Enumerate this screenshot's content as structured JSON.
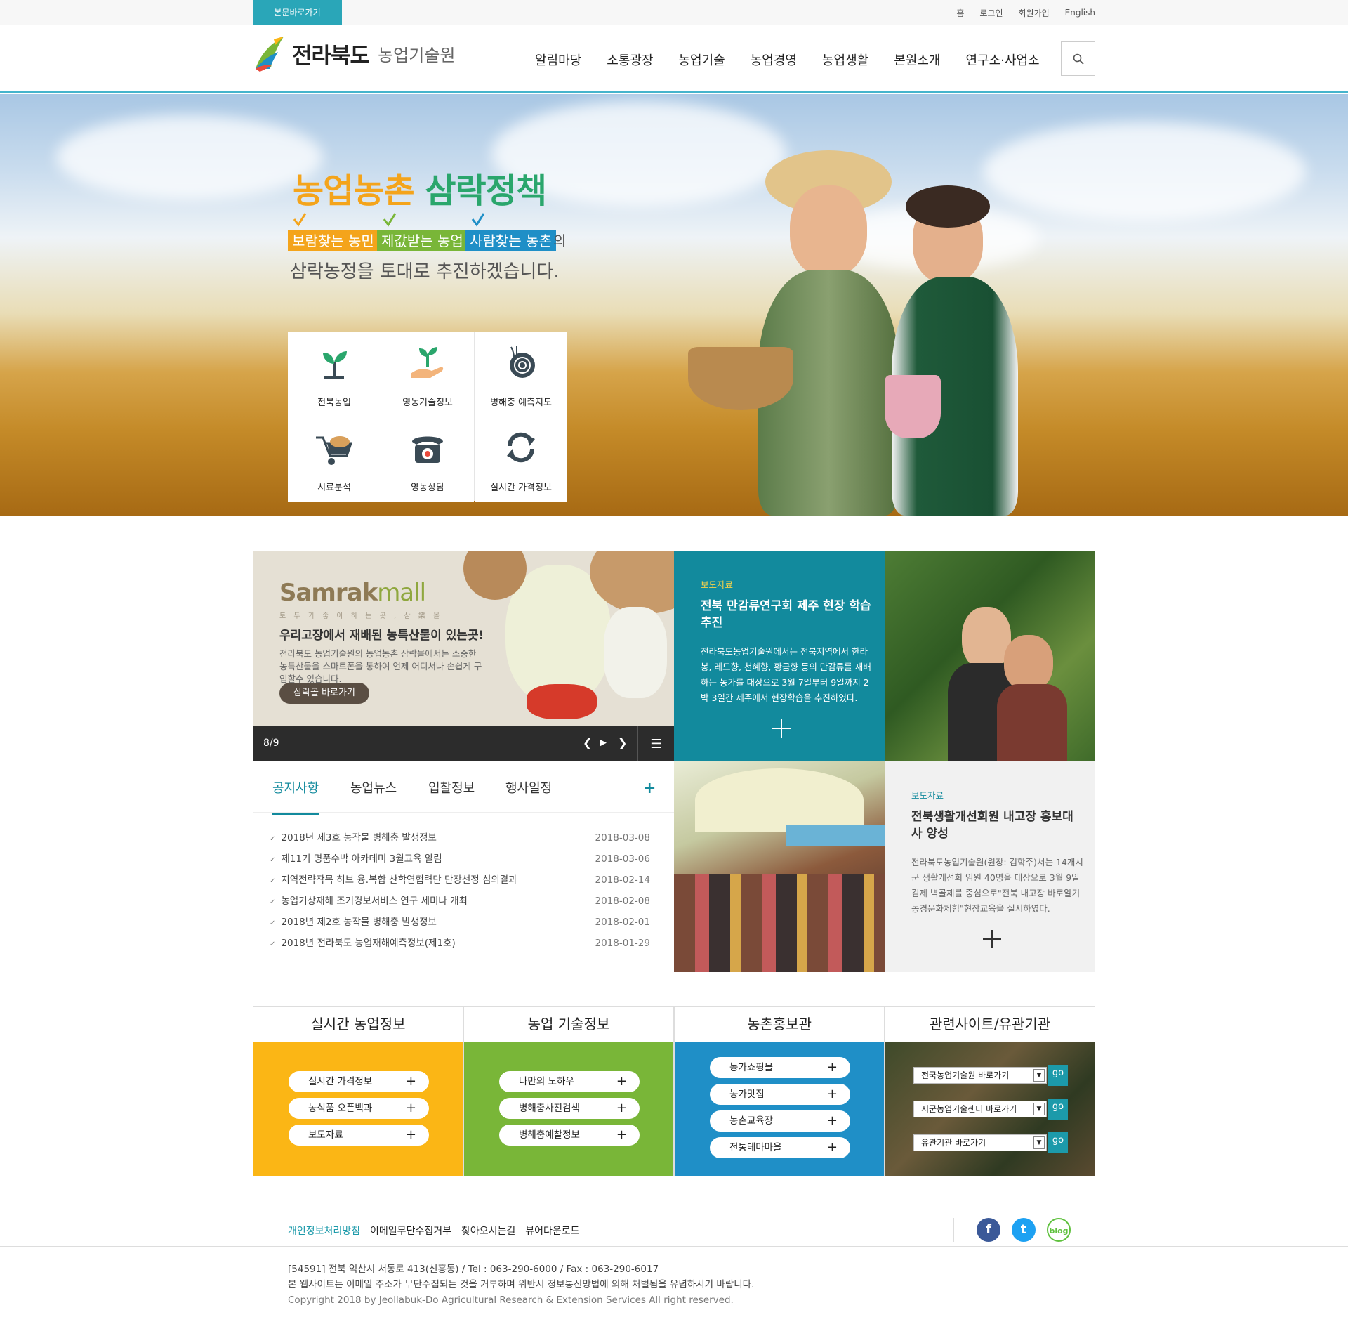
{
  "topbar": {
    "skip": "본문바로가기",
    "links": [
      "홈",
      "로그인",
      "회원가입",
      "English"
    ]
  },
  "header": {
    "logo_main": "전라북도",
    "logo_sub": "농업기술원",
    "nav": [
      "알림마당",
      "소통광장",
      "농업기술",
      "농업경영",
      "농업생활",
      "본원소개",
      "연구소·사업소"
    ],
    "search_icon": "search-icon"
  },
  "hero": {
    "title1": "농업농촌",
    "title2": "삼락정책",
    "hl1": "보람찾는 농민",
    "hl2": "제값받는 농업",
    "hl3": "사람찾는 농촌",
    "hl_suffix": "의",
    "sub": "삼락농정을 토대로 추진하겠습니다.",
    "quick": [
      {
        "label": "전북농업",
        "icon": "sprout-icon"
      },
      {
        "label": "영농기술정보",
        "icon": "hand-sprout-icon"
      },
      {
        "label": "병해충 예측지도",
        "icon": "snail-icon"
      },
      {
        "label": "시료분석",
        "icon": "wheelbarrow-icon"
      },
      {
        "label": "영농상담",
        "icon": "phone-icon"
      },
      {
        "label": "실시간 가격정보",
        "icon": "refresh-icon"
      }
    ]
  },
  "mall": {
    "logo_a": "Samrak",
    "logo_b": "mall",
    "slogan": "토 두 가  좋 아 하 는  곳 ,  삼 樂 몰",
    "headline": "우리고장에서 재배된 농특산물이 있는곳!",
    "body": "전라북도 농업기술원의 농업농촌 삼락몰에서는 소중한 농특산물을 스마트폰을 통하여 언제 어디서나 손쉽게 구입할수 있습니다.",
    "button": "삼락몰 바로가기",
    "counter": "8/9"
  },
  "press1": {
    "tag": "보도자료",
    "title": "전북 만감류연구회 제주 현장 학습 추진",
    "body": "전라북도농업기술원에서는 전북지역에서 한라봉, 레드향, 천혜향, 황금향 등의 만감류를 재배하는 농가를 대상으로 3월 7일부터 9일까지 2박 3일간 제주에서 현장학습을 추진하였다."
  },
  "press2": {
    "tag": "보도자료",
    "title": "전북생활개선회원 내고장 홍보대사 양성",
    "body": "전라북도농업기술원(원장: 김학주)서는 14개시군 생활개선회 임원 40명을 대상으로 3월 9일 김제 벽골제를 중심으로\"전북 내고장 바로알기 농경문화체험\"현장교육을 실시하였다."
  },
  "tabs": [
    "공지사항",
    "농업뉴스",
    "입찰정보",
    "행사일정"
  ],
  "notices": [
    {
      "title": "2018년 제3호 농작물 병해충 발생정보",
      "date": "2018-03-08"
    },
    {
      "title": "제11기 명품수박 아카데미 3월교육 알림",
      "date": "2018-03-06"
    },
    {
      "title": "지역전략작목 허브 융.복합 산학연협력단 단장선정 심의결과",
      "date": "2018-02-14"
    },
    {
      "title": "농업기상재해 조기경보서비스 연구 세미나 개최",
      "date": "2018-02-08"
    },
    {
      "title": "2018년 제2호 농작물 병해충 발생정보",
      "date": "2018-02-01"
    },
    {
      "title": "2018년 전라북도 농업재해예측정보(제1호)",
      "date": "2018-01-29"
    }
  ],
  "boxes": [
    {
      "title": "실시간 농업정보",
      "color": "#fbb615",
      "items": [
        "실시간 가격정보",
        "농식품 오픈백과",
        "보도자료"
      ]
    },
    {
      "title": "농업 기술정보",
      "color": "#79b638",
      "items": [
        "나만의 노하우",
        "병해충사진검색",
        "병해충예찰정보"
      ]
    },
    {
      "title": "농촌홍보관",
      "color": "#1f8fc7",
      "items": [
        "농가쇼핑몰",
        "농가맛집",
        "농촌교육장",
        "전통테마마을"
      ]
    },
    {
      "title": "관련사이트/유관기관",
      "selects": [
        "전국농업기술원 바로가기",
        "시군농업기술센터 바로가기",
        "유관기관 바로가기"
      ],
      "go": "go"
    }
  ],
  "footer": {
    "links": [
      "개인정보처리방침",
      "이메일무단수집거부",
      "찾아오시는길",
      "뷰어다운로드"
    ],
    "address": "[54591] 전북 익산시 서동로 413(신흥동)   / Tel : 063-290-6000   / Fax : 063-290-6017",
    "notice": "본 웹사이트는 이메일 주소가 무단수집되는 것을 거부하며 위반시 정보통신망법에 의해 처벌됨을 유념하시기 바랍니다.",
    "copyright": "Copyright 2018 by Jeollabuk-Do Agricultural Research & Extension Services All right reserved.",
    "social": [
      {
        "name": "facebook-icon",
        "glyph": "f",
        "color": "#3b5998"
      },
      {
        "name": "twitter-icon",
        "glyph": "t",
        "color": "#1da1f2"
      },
      {
        "name": "blog-icon",
        "glyph": "b",
        "color": "#5fc13e"
      }
    ]
  }
}
